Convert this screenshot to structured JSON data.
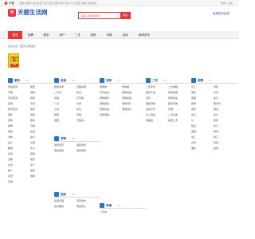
{
  "topbar": {
    "city": "天都",
    "cities": "天都 湛紫华 昌屯北港 天东 京宣 海阳 南宁 杭州 广州 西安 成都 更多城市",
    "auth": "登录 | 注册"
  },
  "logo": {
    "mark": "天",
    "name": "天都生活网"
  },
  "search": {
    "placeholder": "请输入搜索关键字",
    "button_label": "搜索"
  },
  "publish_label": "免费发布信息",
  "nav": {
    "tabs": [
      {
        "label": "首页",
        "active": true
      },
      {
        "label": "招聘"
      },
      {
        "label": "服务"
      },
      {
        "label": "房产"
      },
      {
        "label": "二手"
      },
      {
        "label": "宠物"
      },
      {
        "label": "车辆"
      },
      {
        "label": "招商"
      },
      {
        "label": "新闻资讯"
      }
    ]
  },
  "breadcrumb": "您的位置: 天都生活网首页",
  "ad": {
    "line1": "天都生活网",
    "line2": "信息发布",
    "button": "点击"
  },
  "sections": [
    {
      "title": "服务",
      "count": "(0)",
      "items": [
        "家政保洁",
        "搬家",
        "开锁",
        "维修",
        "管道疏通",
        "装修",
        "回收",
        "清洗",
        "教育培训",
        "婚庆",
        "摄影",
        "旅游",
        "家教",
        "租车",
        "保姆",
        "月嫂",
        "搬运",
        "快递",
        "法律",
        "会计",
        "设计",
        "印刷",
        "翻译",
        "礼仪",
        "商务",
        "其他",
        "宠物",
        "保安",
        "办证",
        "中介",
        "婚介",
        "殡葬",
        "养老",
        "维权",
        "咨询"
      ]
    },
    {
      "title": "房屋",
      "count": "(0)",
      "items": [
        "整租房屋",
        "合租房屋",
        "二手房",
        "新房",
        "商铺",
        "写字楼",
        "厂房",
        "仓库",
        "土地",
        "车位",
        "求租",
        "求购",
        "短租",
        "日租房"
      ]
    },
    {
      "title": "宠物",
      "count": "(0)",
      "items": [
        "宠物狗",
        "宠物猫",
        "花鸟鱼虫",
        "宠物用品",
        "宠物服务",
        "宠物医院",
        "宠物美容",
        "宠物寄养",
        "宠物食品",
        "宠物领养",
        "其他宠物"
      ]
    },
    {
      "title": "二手",
      "count": "(0)",
      "items": [
        "二手手机",
        "二手电脑",
        "数码产品",
        "家用电器",
        "家具",
        "母婴用品",
        "服装鞋帽",
        "图书音像",
        "运动户外",
        "乐器",
        "办公用品",
        "二手设备",
        "收藏品",
        "其他二手"
      ]
    },
    {
      "title": "招聘",
      "count": "(0)",
      "items": [
        "普工",
        "司机",
        "销售",
        "文员",
        "客服",
        "会计",
        "厨师",
        "服务员",
        "保安",
        "保洁",
        "技工",
        "设计",
        "IT",
        "教师",
        "医生",
        "护士",
        "美容",
        "物流",
        "电工",
        "焊工",
        "仓管",
        "导购",
        "兼职",
        "其他"
      ]
    },
    {
      "title": "求职",
      "count": "(0)",
      "items": [
        "求职简历",
        "兼职求职",
        "家教求职",
        "保姆求职"
      ]
    },
    {
      "title": "招商",
      "count": "(0)",
      "items": [
        "加盟代理",
        "项目合作",
        "投资理财",
        "网店转让"
      ]
    },
    {
      "title": "车辆",
      "count": "(0)",
      "items": [
        "二手车"
      ]
    }
  ]
}
